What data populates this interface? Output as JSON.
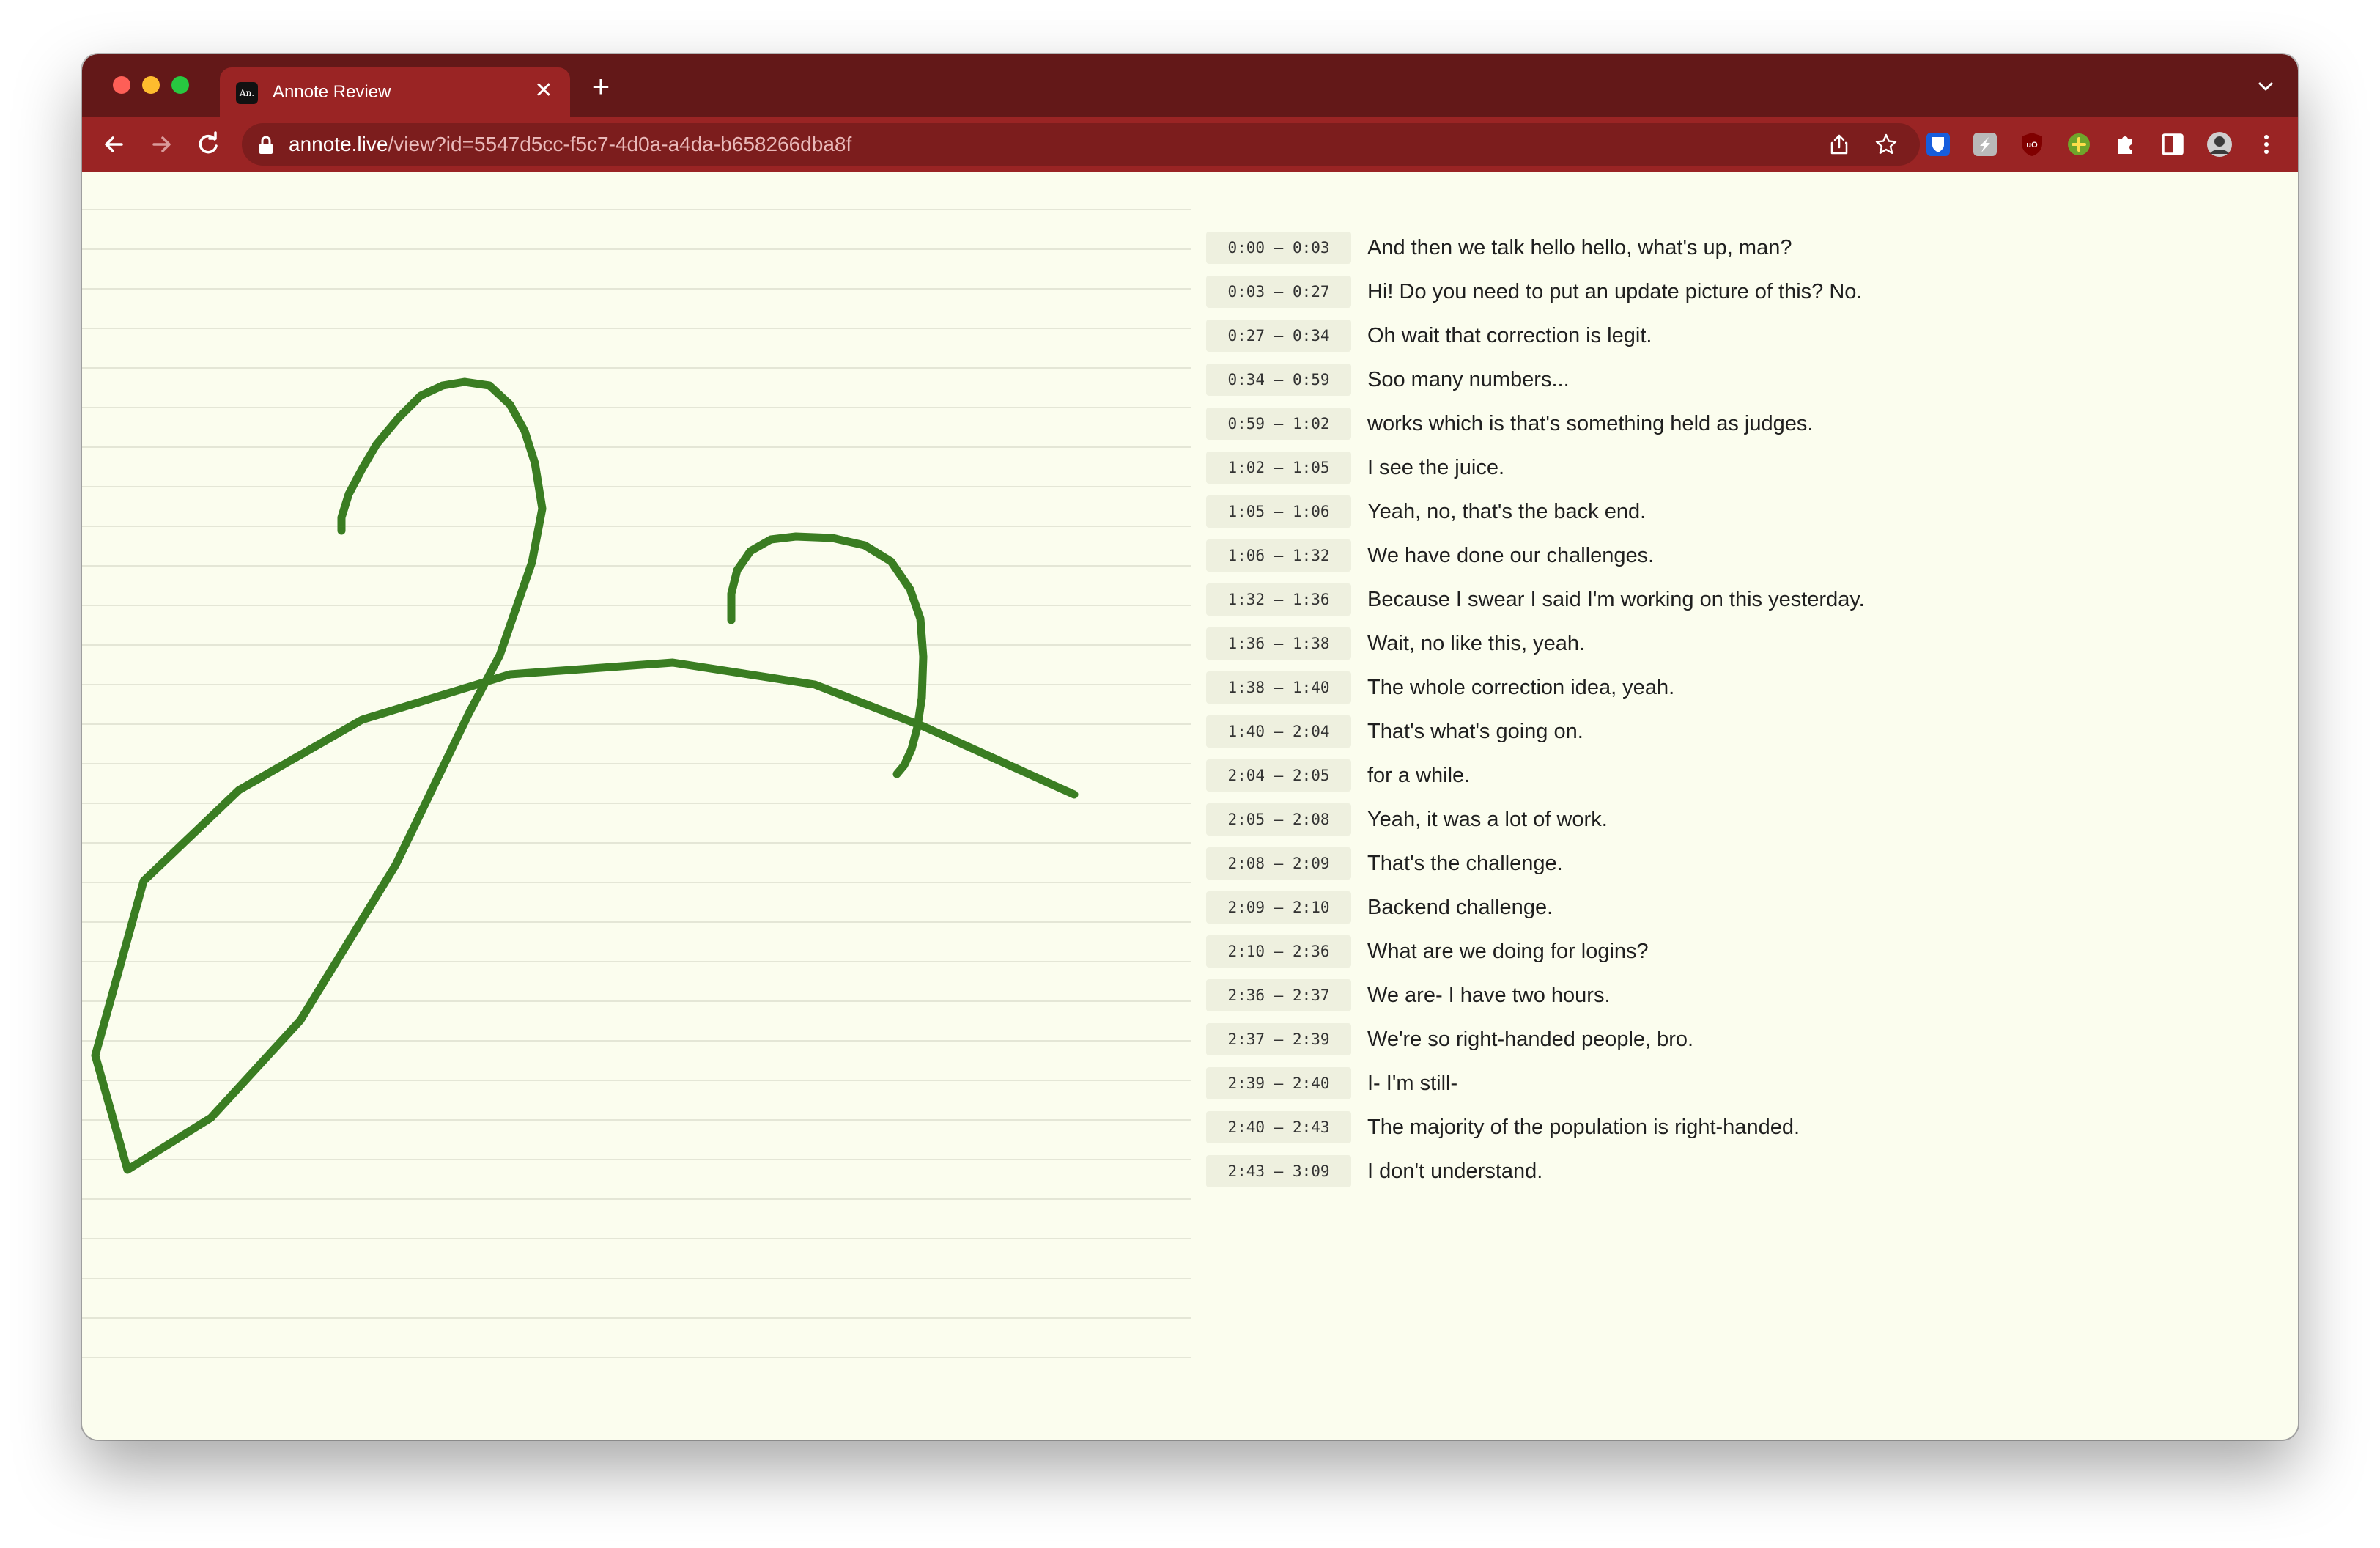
{
  "browser": {
    "tab": {
      "favicon_text": "An.",
      "title": "Annote Review",
      "close_glyph": "✕"
    },
    "new_tab_glyph": "+",
    "url_host": "annote.live",
    "url_path": "/view?id=5547d5cc-f5c7-4d0a-a4da-b658266dba8f",
    "extensions": [
      "bitwarden-icon",
      "notes-extension-icon",
      "ublock-origin-icon",
      "green-plus-extension-icon",
      "puzzle-extensions-icon",
      "side-panel-icon",
      "profile-avatar",
      "menu-kebab-icon"
    ]
  },
  "colors": {
    "frame": "#631818",
    "toolbar": "#9a2424",
    "page_bg": "#fbfdee",
    "ink": "#3a7d22",
    "rule_line": "#e4e6d6"
  },
  "transcript": [
    {
      "start": "0:00",
      "end": "0:03",
      "text": "And then we talk hello hello, what's up, man?"
    },
    {
      "start": "0:03",
      "end": "0:27",
      "text": "Hi! Do you need to put an update picture of this? No."
    },
    {
      "start": "0:27",
      "end": "0:34",
      "text": "Oh wait that correction is legit."
    },
    {
      "start": "0:34",
      "end": "0:59",
      "text": "Soo many numbers..."
    },
    {
      "start": "0:59",
      "end": "1:02",
      "text": "works which is that's something held as judges."
    },
    {
      "start": "1:02",
      "end": "1:05",
      "text": "I see the juice."
    },
    {
      "start": "1:05",
      "end": "1:06",
      "text": "Yeah, no, that's the back end."
    },
    {
      "start": "1:06",
      "end": "1:32",
      "text": "We have done our challenges."
    },
    {
      "start": "1:32",
      "end": "1:36",
      "text": "Because I swear I said I'm working on this yesterday."
    },
    {
      "start": "1:36",
      "end": "1:38",
      "text": "Wait, no like this, yeah."
    },
    {
      "start": "1:38",
      "end": "1:40",
      "text": "The whole correction idea, yeah."
    },
    {
      "start": "1:40",
      "end": "2:04",
      "text": "That's what's going on."
    },
    {
      "start": "2:04",
      "end": "2:05",
      "text": "for a while."
    },
    {
      "start": "2:05",
      "end": "2:08",
      "text": "Yeah, it was a lot of work."
    },
    {
      "start": "2:08",
      "end": "2:09",
      "text": "That's the challenge."
    },
    {
      "start": "2:09",
      "end": "2:10",
      "text": "Backend challenge."
    },
    {
      "start": "2:10",
      "end": "2:36",
      "text": "What are we doing for logins?"
    },
    {
      "start": "2:36",
      "end": "2:37",
      "text": "We are- I have two hours."
    },
    {
      "start": "2:37",
      "end": "2:39",
      "text": "We're so right-handed people, bro."
    },
    {
      "start": "2:39",
      "end": "2:40",
      "text": "I- I'm still-"
    },
    {
      "start": "2:40",
      "end": "2:43",
      "text": "The majority of the population is right-handed."
    },
    {
      "start": "2:43",
      "end": "3:09",
      "text": "I don't understand."
    }
  ]
}
